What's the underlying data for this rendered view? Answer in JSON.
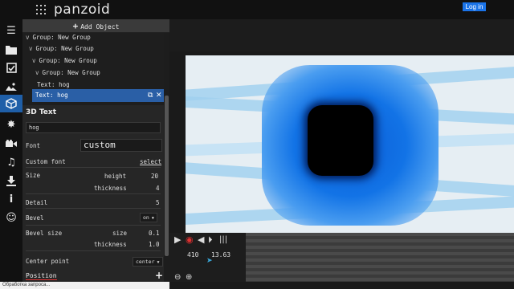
{
  "topbar": {
    "brand": "panzoid",
    "login_label": "Log in"
  },
  "rail": {
    "icons": [
      "menu-icon",
      "folder-icon",
      "checkbox-icon",
      "image-icon",
      "cube-icon",
      "sparkle-icon",
      "camera-icon",
      "music-icon",
      "download-icon",
      "info-icon",
      "smiley-icon"
    ],
    "active": "cube-icon"
  },
  "panel": {
    "add_object_label": "Add Object",
    "tree": [
      {
        "label": "Group: New Group"
      },
      {
        "label": "Group: New Group"
      },
      {
        "label": "Group: New Group"
      },
      {
        "label": "Group: New Group"
      },
      {
        "label": "Text: hog"
      }
    ],
    "selected": {
      "label": "Text: hog"
    },
    "section_title": "3D Text",
    "name_value": "hog",
    "font_label": "Font",
    "font_value": "custom",
    "custom_font_label": "Custom font",
    "custom_font_action": "select",
    "size_label": "Size",
    "height_label": "height",
    "height_value": "20",
    "thickness_label": "thickness",
    "thickness_value": "4",
    "detail_label": "Detail",
    "detail_value": "5",
    "bevel_label": "Bevel",
    "bevel_value": "on",
    "bevel_size_label": "Bevel size",
    "bevel_size_sub": "size",
    "bevel_size_value": "0.1",
    "bevel_thickness_label": "thickness",
    "bevel_thickness_value": "1.0",
    "center_label": "Center point",
    "center_value": "center",
    "position_label": "Position"
  },
  "timeline": {
    "frame": "410",
    "time": "13.63"
  },
  "status": {
    "text": "Обработка запроса..."
  },
  "colors": {
    "accent": "#2a5fa6",
    "login": "#1a73e8",
    "record": "#e03030"
  }
}
